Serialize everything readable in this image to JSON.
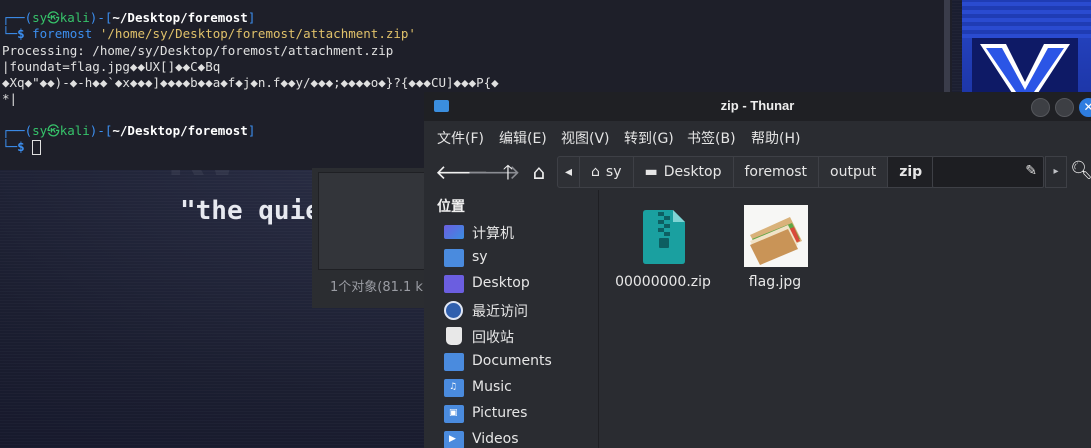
{
  "terminal": {
    "prompt1": {
      "user": "sy",
      "host": "kali",
      "path": "~/Desktop/foremost"
    },
    "command": "foremost",
    "command_arg": "'/home/sy/Desktop/foremost/attachment.zip'",
    "output": [
      "Processing: /home/sy/Desktop/foremost/attachment.zip",
      "|foundat=flag.jpg◆◆UX[]◆◆C◆Bq",
      "◆Xq◆\"◆◆)-◆-h◆◆`◆x◆◆◆]◆◆◆◆b◆◆a◆f◆j◆n.f◆◆y/◆◆◆;◆◆◆◆o◆}?{◆◆◆CU]◆◆◆P{◆",
      "*|"
    ],
    "prompt2": {
      "user": "sy",
      "host": "kali",
      "path": "~/Desktop/foremost"
    }
  },
  "wallpaper": {
    "quote": "\"the quie"
  },
  "ghost": {
    "status": "1个对象(81.1 k"
  },
  "window": {
    "title": "zip - Thunar",
    "close_glyph": "✕"
  },
  "menu": [
    "文件(F)",
    "编辑(E)",
    "视图(V)",
    "转到(G)",
    "书签(B)",
    "帮助(H)"
  ],
  "path": {
    "crumbs": [
      "sy",
      "Desktop",
      "foremost",
      "output",
      "zip"
    ],
    "left_arrow": "◂",
    "right_arrow": "▸"
  },
  "sidebar": {
    "heading": "位置",
    "items": [
      {
        "label": "计算机",
        "icon": "computer-icon"
      },
      {
        "label": "sy",
        "icon": "home-folder-icon"
      },
      {
        "label": "Desktop",
        "icon": "desktop-folder-icon"
      },
      {
        "label": "最近访问",
        "icon": "recent-icon"
      },
      {
        "label": "回收站",
        "icon": "trash-icon"
      },
      {
        "label": "Documents",
        "icon": "documents-folder-icon"
      },
      {
        "label": "Music",
        "icon": "music-folder-icon"
      },
      {
        "label": "Pictures",
        "icon": "pictures-folder-icon"
      },
      {
        "label": "Videos",
        "icon": "videos-folder-icon"
      }
    ]
  },
  "files": [
    {
      "name": "00000000.zip",
      "icon": "zip-file-icon"
    },
    {
      "name": "flag.jpg",
      "icon": "image-thumbnail"
    }
  ],
  "colors": {
    "accent": "#2e7de0",
    "terminal_bg": "#1e1f29",
    "window_bg": "#2a2c31"
  }
}
